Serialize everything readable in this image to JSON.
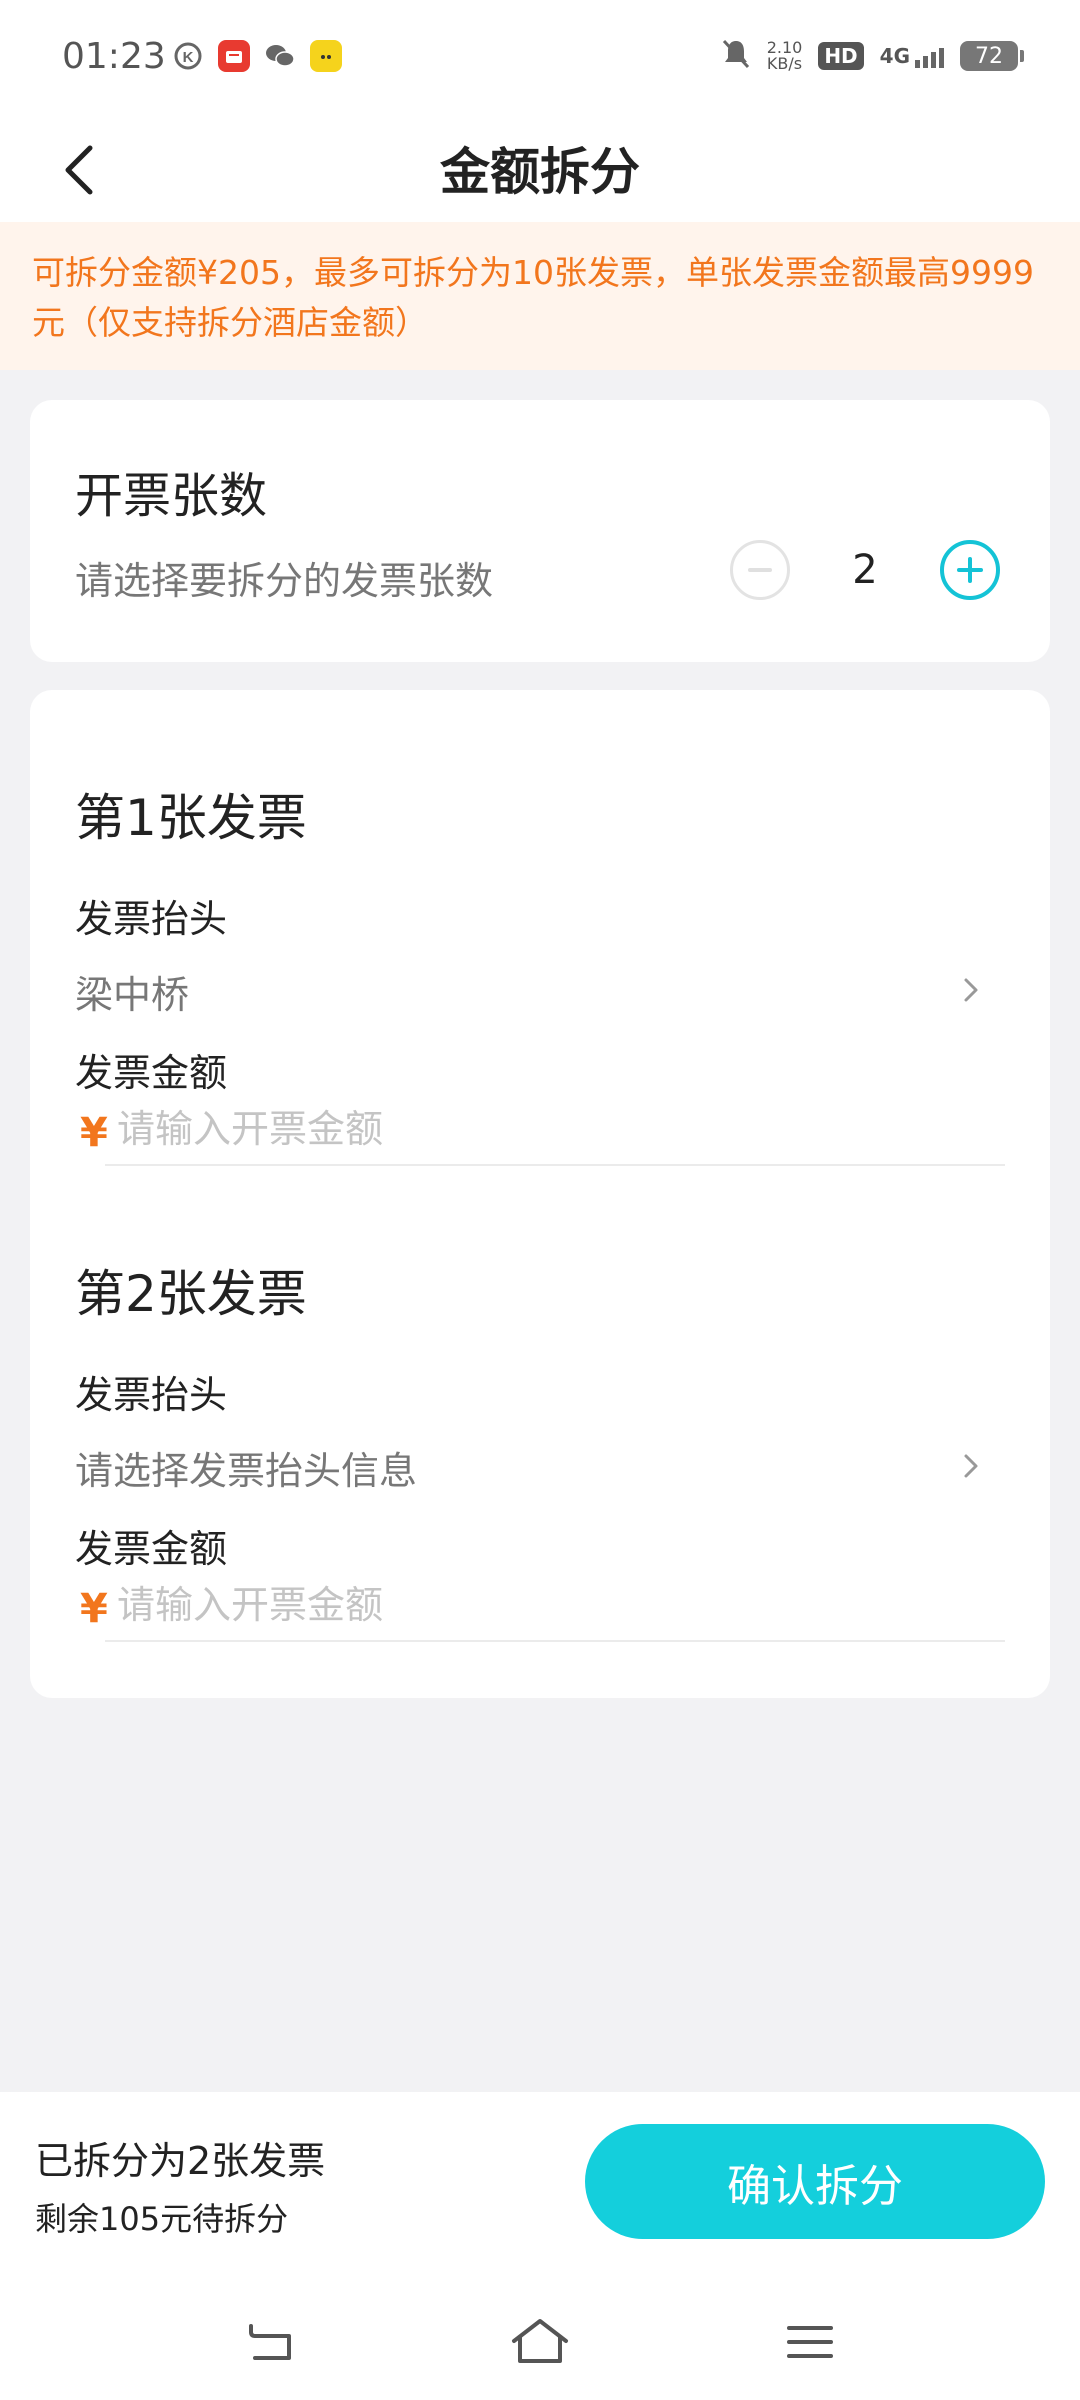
{
  "status_bar": {
    "time": "01:23",
    "net_speed_value": "2.10",
    "net_speed_unit": "KB/s",
    "hd": "HD",
    "network": "4G",
    "battery": "72",
    "left_icons": [
      "k-icon",
      "shop-icon",
      "wechat-icon",
      "yellow-app-icon"
    ]
  },
  "header": {
    "title": "金额拆分"
  },
  "notice": {
    "text": "可拆分金额¥205，最多可拆分为10张发票，单张发票金额最高9999元（仅支持拆分酒店金额）"
  },
  "count_card": {
    "title": "开票张数",
    "subtitle": "请选择要拆分的发票张数",
    "value": "2"
  },
  "invoices": [
    {
      "title": "第1张发票",
      "header_label": "发票抬头",
      "header_value": "梁中桥",
      "amount_label": "发票金额",
      "currency": "¥",
      "amount_placeholder": "请输入开票金额"
    },
    {
      "title": "第2张发票",
      "header_label": "发票抬头",
      "header_value": "请选择发票抬头信息",
      "amount_label": "发票金额",
      "currency": "¥",
      "amount_placeholder": "请输入开票金额"
    }
  ],
  "bottom": {
    "summary": "已拆分为2张发票",
    "remaining": "剩余105元待拆分",
    "confirm_label": "确认拆分"
  },
  "colors": {
    "accent": "#14cfdc",
    "orange": "#f2761d",
    "notice_bg": "#fff4ec",
    "page_bg": "#f2f2f4"
  }
}
